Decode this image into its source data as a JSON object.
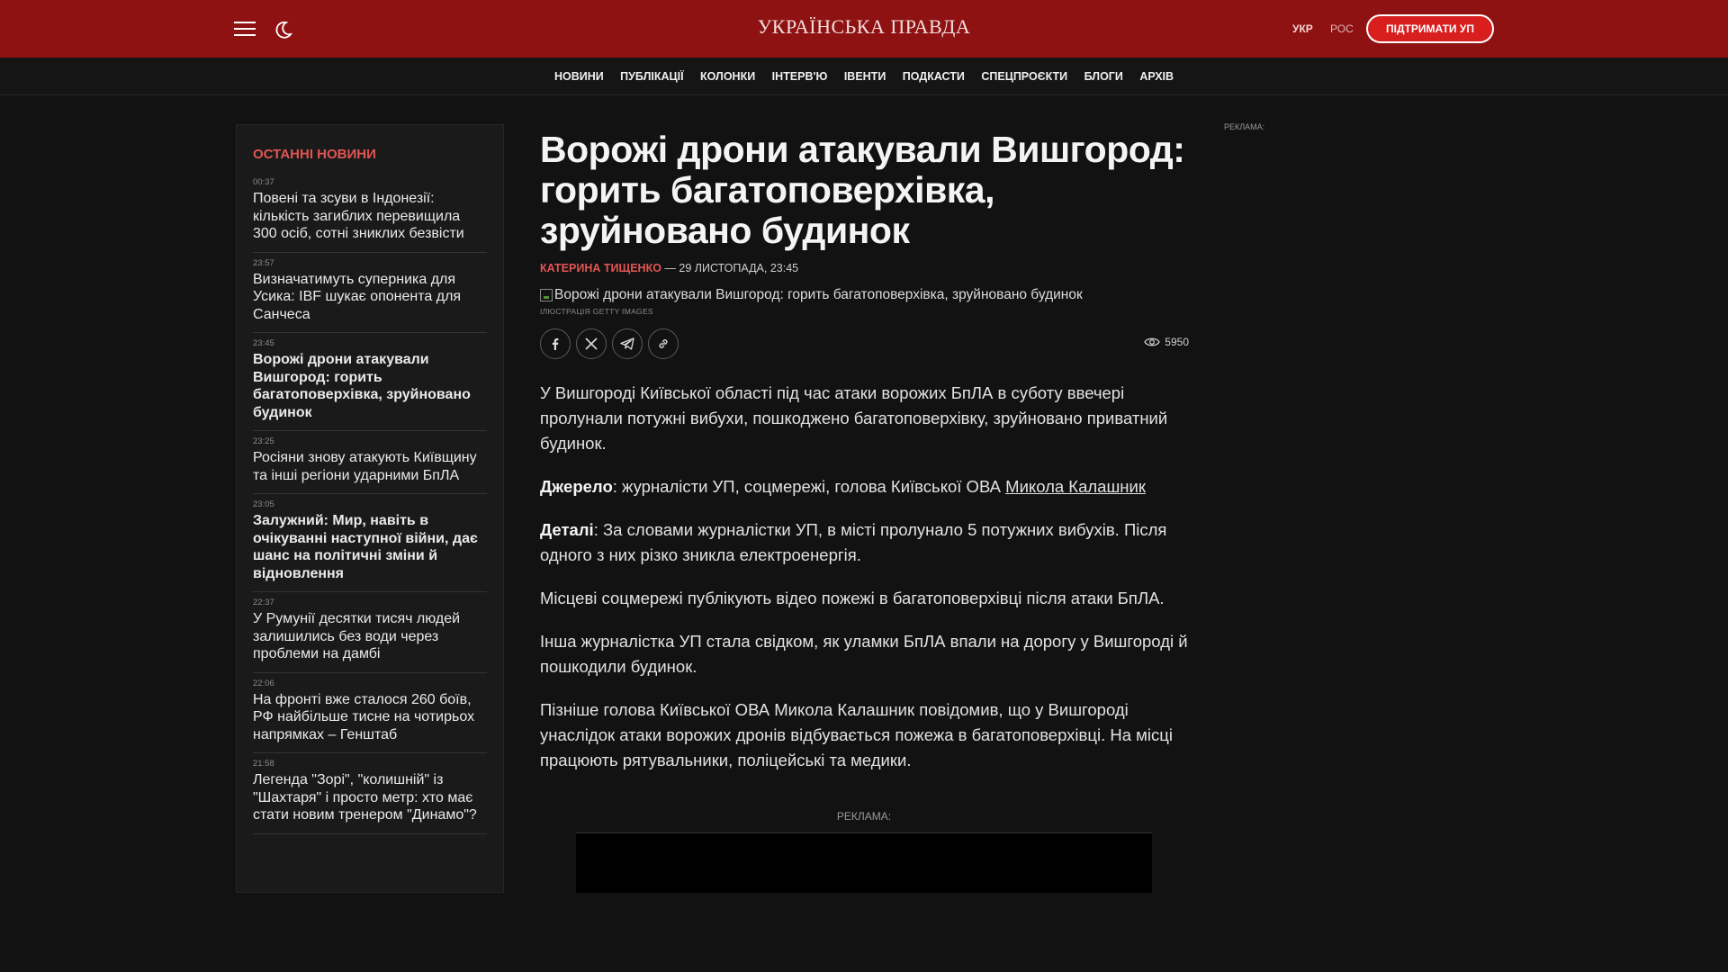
{
  "header": {
    "logo": "УКРАЇНСЬКА ПРАВДА",
    "lang_ukr": "УКР",
    "lang_ros": "РОС",
    "support_label": "ПІДТРИМАТИ УП",
    "menu_icon": "hamburger-menu-icon",
    "theme_icon": "moon-icon"
  },
  "nav": {
    "items": [
      "НОВИНИ",
      "ПУБЛІКАЦІЇ",
      "КОЛОНКИ",
      "ІНТЕРВ'Ю",
      "ІВЕНТИ",
      "ПОДКАСТИ",
      "СПЕЦПРОЄКТИ",
      "БЛОГИ",
      "АРХІВ"
    ]
  },
  "sidebar": {
    "title": "ОСТАННІ НОВИНИ",
    "news": [
      {
        "time": "00:37",
        "title": "Повені та зсуви в Індонезії: кількість загиблих перевищила 300 осіб, сотні зниклих безвісти"
      },
      {
        "time": "23:57",
        "title": "Визначатимуть суперника для Усика: IBF шукає опонента для Санчеса"
      },
      {
        "time": "23:45",
        "title": "Ворожі дрони атакували Вишгород: горить багатоповерхівка, зруйновано будинок"
      },
      {
        "time": "23:25",
        "title": "Росіяни знову атакують Київщину та інші регіони ударними БпЛА"
      },
      {
        "time": "23:05",
        "title": "Залужний: Мир, навіть в очікуванні наступної війни, дає шанс на політичні зміни й відновлення"
      },
      {
        "time": "22:37",
        "title": "У Румунії десятки тисяч людей залишились без води через проблеми на дамбі"
      },
      {
        "time": "22:06",
        "title": "На фронті вже сталося 260 боїв, РФ найбільше тисне на чотирьох напрямках – Генштаб"
      },
      {
        "time": "21:58",
        "title": "Легенда \"Зорі\", \"колишній\" із \"Шахтаря\" і просто метр: хто має стати новим тренером \"Динамо\"?"
      }
    ]
  },
  "article": {
    "headline": "Ворожі дрони атакували Вишгород: горить багатоповерхівка, зруйновано будинок",
    "author": "КАТЕРИНА ТИЩЕНКО",
    "date": " — 29 ЛИСТОПАДА, 23:45",
    "image_alt": "Ворожі дрони атакували Вишгород: горить багатоповерхівка, зруйновано будинок",
    "caption": "ІЛЮСТРАЦІЯ GETTY IMAGES",
    "views": "5950",
    "p1": "У Вишгороді Київської області під час атаки ворожих БпЛА в суботу ввечері пролунали потужні вибухи, пошкоджено багатоповерхівку, зруйновано приватний будинок.",
    "p2_label": "Джерело",
    "p2_text": ": журналісти УП, соцмережі, голова Київської ОВА ",
    "p2_link": "Микола Калашник",
    "p3_label": "Деталі",
    "p3_text": ": За словами журналістки УП, в місті пролунало 5 потужних вибухів. Після одного з них різко зникла електроенергія.",
    "p4": "Місцеві соцмережі публікують відео пожежі в багатоповерхівці після атаки БпЛА.",
    "p5": "Інша журналістка УП стала свідком, як уламки БпЛА впали на дорогу у Вишгороді й пошкодили будинок.",
    "p6": "Пізніше голова Київської ОВА Микола Калашник повідомив, що у Вишгороді унаслідок атаки ворожих дронів відбувається пожежа в багатоповерхівці. На місці працюють рятувальники, поліцейські та медики."
  },
  "ads": {
    "label_mid": "РЕКЛАМА:",
    "label_right": "РЕКЛАМА:"
  },
  "colors": {
    "header_bg": "#8f1212",
    "accent": "#e35454",
    "support_button": "#d91e1e",
    "page_bg": "#121212"
  }
}
